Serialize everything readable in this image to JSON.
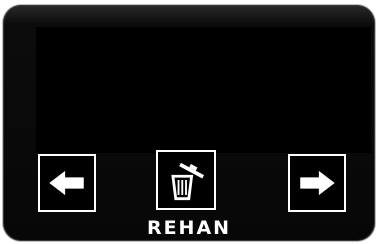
{
  "device": {
    "brand": "REHAN"
  },
  "controls": {
    "previous_icon": "arrow-left-icon",
    "delete_icon": "trash-icon",
    "next_icon": "arrow-right-icon"
  },
  "colors": {
    "bezel": "#070707",
    "screen": "#000000",
    "button_border": "#ffffff",
    "icon": "#ffffff"
  }
}
